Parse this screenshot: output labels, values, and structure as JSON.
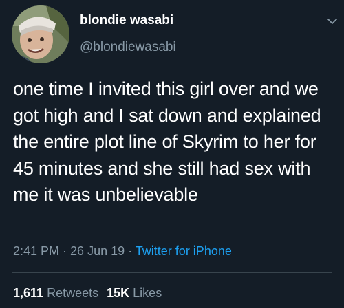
{
  "author": {
    "name": "blondie wasabi",
    "handle": "@blondiewasabi"
  },
  "tweet": {
    "text": "one time I invited this girl over and we got high and I sat down and explained the entire plot line of Skyrim to her for 45 minutes and she still had sex with me it was unbelievable",
    "time": "2:41 PM",
    "date": "26 Jun 19",
    "separator": " · ",
    "source": "Twitter for iPhone"
  },
  "stats": {
    "retweets_count": "1,611",
    "retweets_label": "Retweets",
    "likes_count": "15K",
    "likes_label": "Likes"
  },
  "icons": {
    "menu": "chevron-down-icon"
  },
  "colors": {
    "background": "#141d27",
    "secondary_text": "#8899a6",
    "accent": "#1da1f2"
  }
}
